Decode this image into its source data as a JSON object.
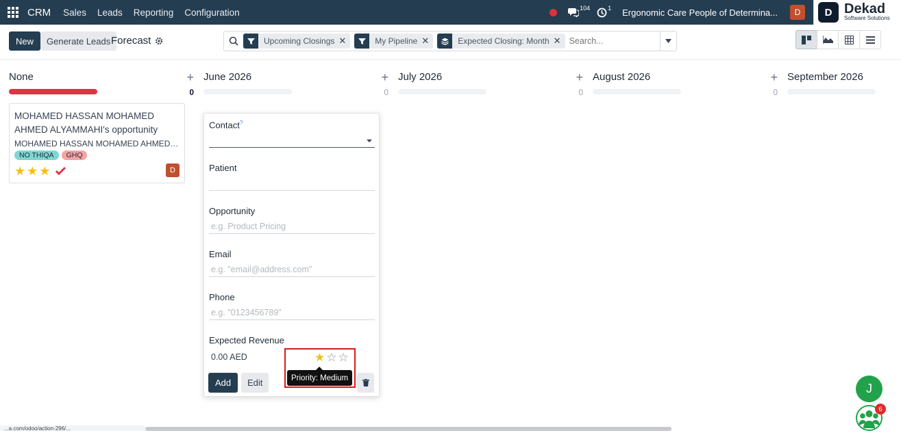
{
  "nav": {
    "brand": "CRM",
    "menus": [
      "Sales",
      "Leads",
      "Reporting",
      "Configuration"
    ],
    "messages_count": "104",
    "activities_count": "1",
    "company": "Ergonomic Care People of Determina...",
    "user_initial": "D"
  },
  "logo": {
    "mark": "D",
    "name": "Dekad",
    "tagline": "Software Solutions"
  },
  "control": {
    "new_label": "New",
    "generate_label": "Generate Leads",
    "title": "Forecast",
    "facets": [
      "Upcoming Closings",
      "My Pipeline",
      "Expected Closing: Month"
    ],
    "search_placeholder": "Search..."
  },
  "columns": [
    {
      "title": "None",
      "count": "0"
    },
    {
      "title": "June 2026",
      "count": "0"
    },
    {
      "title": "July 2026",
      "count": "0"
    },
    {
      "title": "August 2026",
      "count": "0"
    },
    {
      "title": "September 2026",
      "count": ""
    }
  ],
  "card": {
    "title": "MOHAMED HASSAN MOHAMED AHMED ALYAMMAHI's opportunity",
    "subtitle": "MOHAMED HASSAN MOHAMED AHMED A...",
    "tags": [
      "NO THIQA",
      "GHQ"
    ],
    "priority_stars": 3,
    "avatar": "D"
  },
  "quick_create": {
    "contact_label": "Contact",
    "contact_help": "?",
    "patient_label": "Patient",
    "opportunity_label": "Opportunity",
    "opportunity_placeholder": "e.g. Product Pricing",
    "email_label": "Email",
    "email_placeholder": "e.g. \"email@address.com\"",
    "phone_label": "Phone",
    "phone_placeholder": "e.g. \"0123456789\"",
    "revenue_label": "Expected Revenue",
    "revenue_value": "0.00 AED",
    "priority_filled": 1,
    "priority_tooltip": "Priority: Medium",
    "add_label": "Add",
    "edit_label": "Edit"
  },
  "floating": {
    "chat_initial": "J",
    "chat_badge": "6"
  },
  "status_url": "...a.com/odoo/action-296/..."
}
